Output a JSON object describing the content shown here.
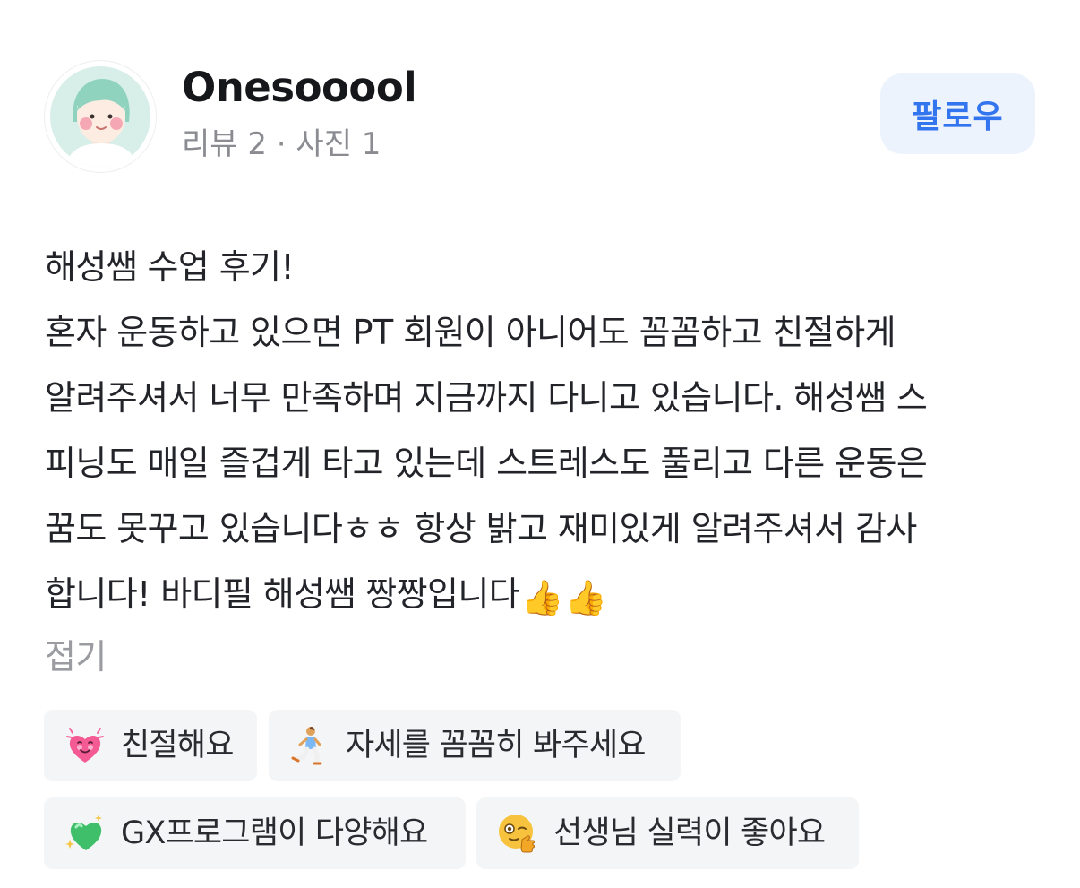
{
  "profile": {
    "username": "Onesooool",
    "stats": "리뷰 2 · 사진 1",
    "avatar_icon": "avatar-illustration-icon"
  },
  "follow_button": {
    "label": "팔로우",
    "color": "#3374ef",
    "background": "#edf3fd"
  },
  "review": {
    "lines": [
      "해성쌤 수업 후기!",
      "혼자 운동하고 있으면 PT 회원이 아니어도 꼼꼼하고 친절하게",
      "알려주셔서 너무 만족하며 지금까지 다니고 있습니다. 해성쌤 스",
      "피닝도 매일 즐겁게 타고 있는데 스트레스도 풀리고 다른 운동은",
      "꿈도 못꾸고 있습니다ㅎㅎ 항상 밝고 재미있게 알려주셔서 감사",
      "합니다! 바디필 해성쌤 짱짱입니다"
    ],
    "trailing_emojis": [
      "👍",
      "👍"
    ],
    "fold_label": "접기"
  },
  "tags": [
    {
      "label": "친절해요",
      "icon": "pink-heart-face-icon"
    },
    {
      "label": "자세를 꼼꼼히 봐주세요",
      "icon": "kneeling-person-icon"
    },
    {
      "label": "GX프로그램이 다양해요",
      "icon": "sparkling-green-heart-icon"
    },
    {
      "label": "선생님 실력이 좋아요",
      "icon": "winking-thumbs-face-icon"
    }
  ]
}
